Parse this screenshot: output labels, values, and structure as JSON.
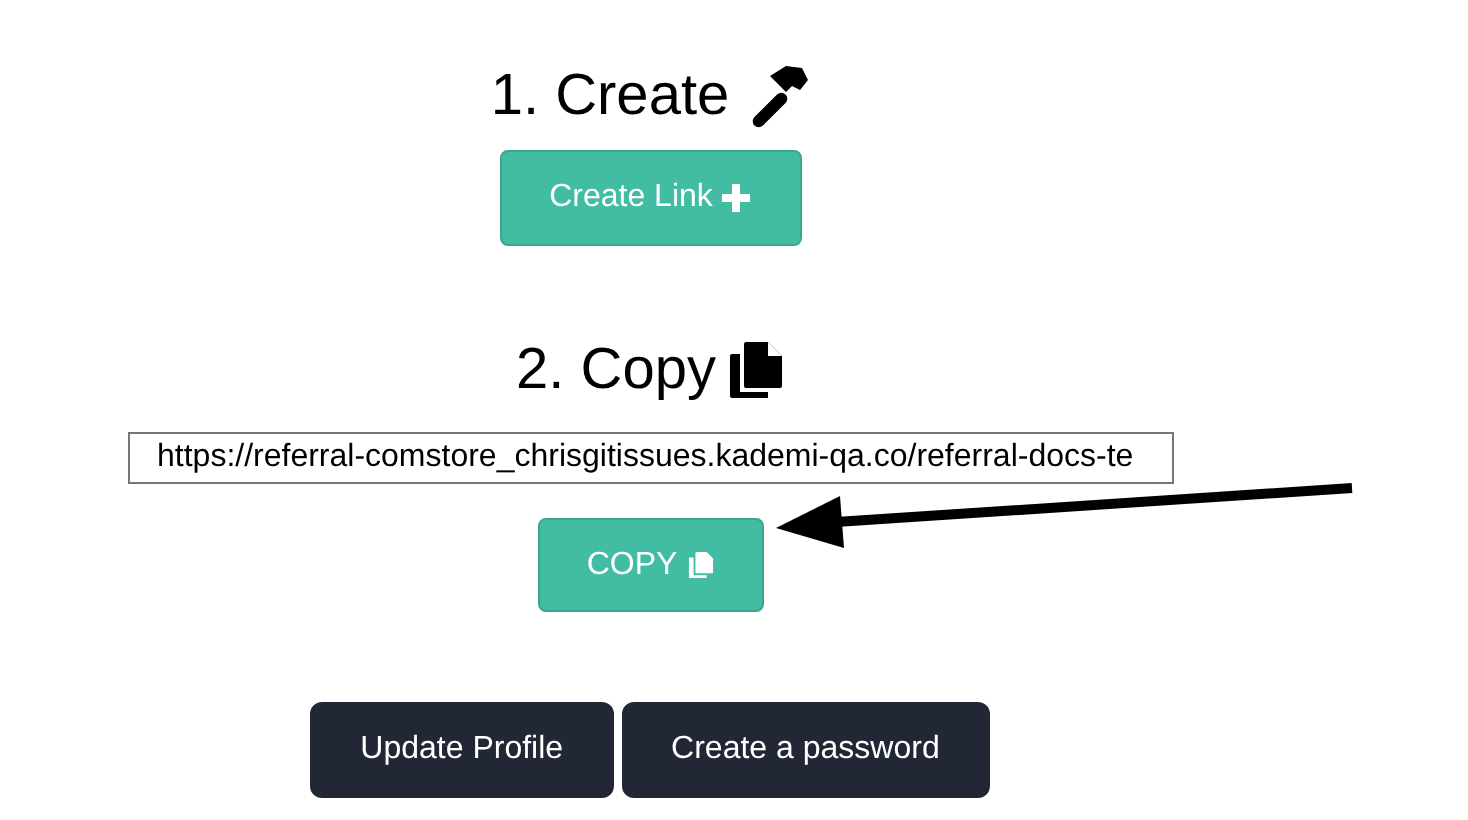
{
  "create": {
    "heading": "1. Create",
    "button": "Create Link"
  },
  "copy": {
    "heading": "2. Copy",
    "link_value": "https://referral-comstore_chrisgitissues.kademi-qa.co/referral-docs-te",
    "button": "COPY"
  },
  "actions": [
    "Update Profile",
    "Create a password"
  ]
}
